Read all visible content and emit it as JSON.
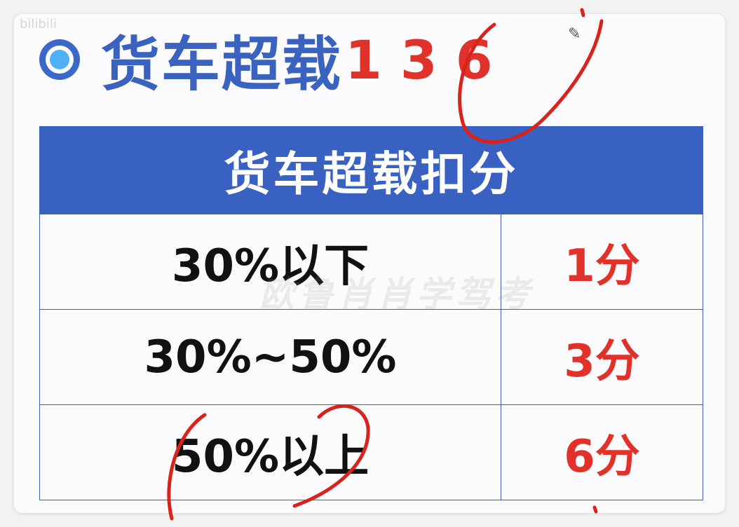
{
  "title": {
    "text": "货车超载",
    "numbers": "136"
  },
  "table": {
    "header": "货车超载扣分",
    "rows": [
      {
        "condition": "30%以下",
        "points": "1分"
      },
      {
        "condition": "30%~50%",
        "points": "3分"
      },
      {
        "condition": "50%以上",
        "points": "6分"
      }
    ]
  },
  "watermark": "欧鲁肖肖学驾考",
  "corner_text": "bilibili",
  "colors": {
    "title_blue": "#3a63c0",
    "header_blue": "#3961c2",
    "accent_red": "#e0322b",
    "ink_red": "#d8231c"
  },
  "icons": [
    "target-bullet-icon",
    "pencil-icon"
  ]
}
